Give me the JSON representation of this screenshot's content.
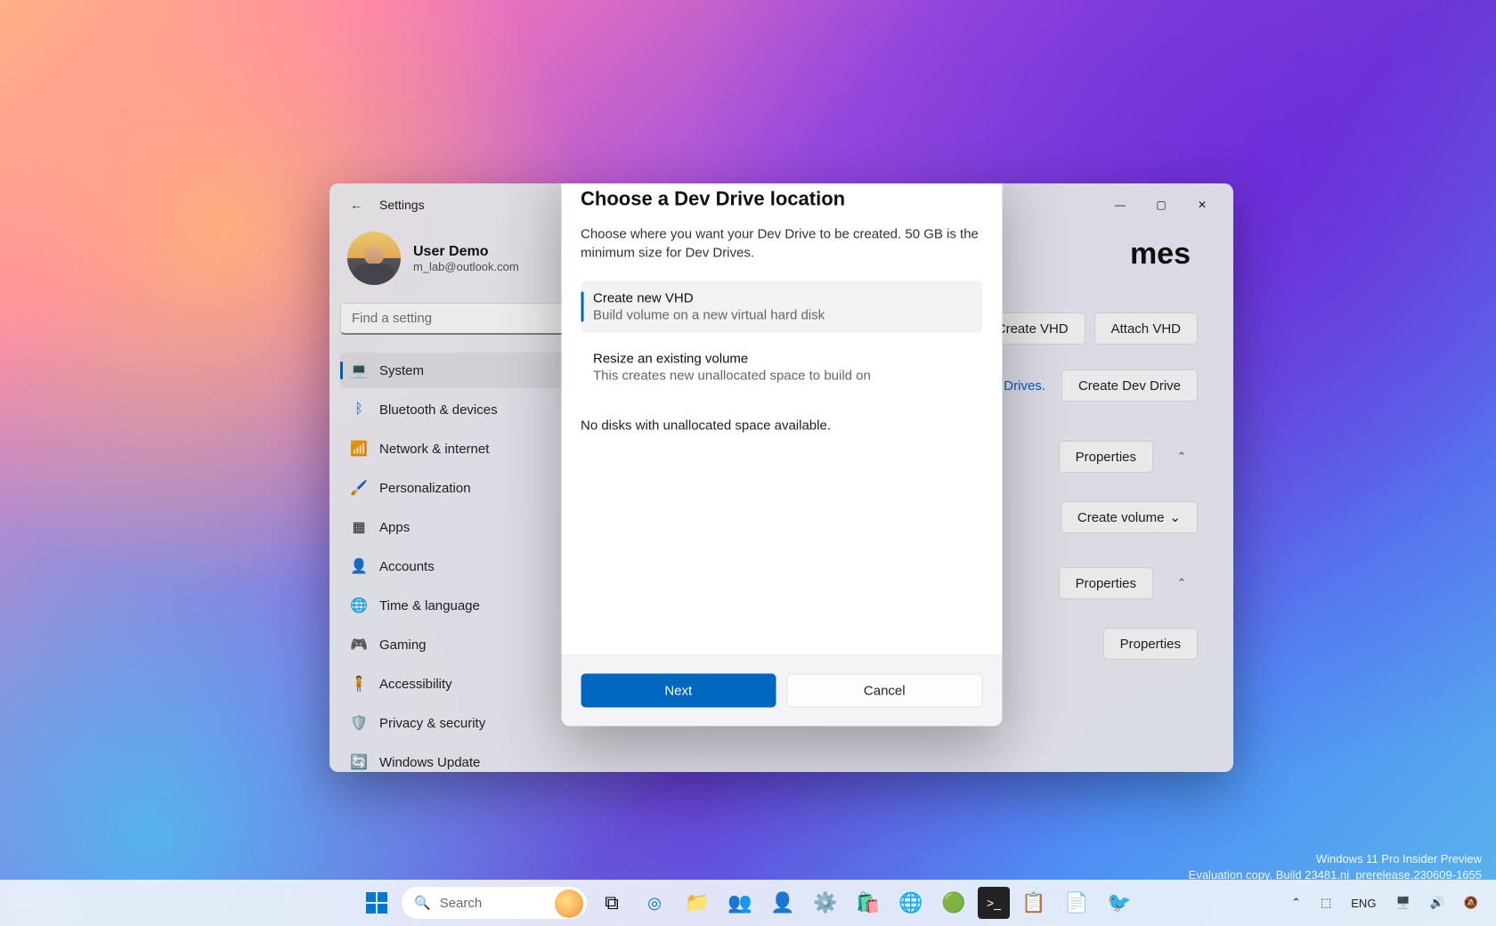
{
  "window": {
    "title": "Settings"
  },
  "user": {
    "name": "User Demo",
    "email": "m_lab@outlook.com"
  },
  "search": {
    "placeholder": "Find a setting"
  },
  "nav": {
    "items": [
      {
        "label": "System",
        "icon": "💻"
      },
      {
        "label": "Bluetooth & devices",
        "icon": "ᛒ"
      },
      {
        "label": "Network & internet",
        "icon": "📶"
      },
      {
        "label": "Personalization",
        "icon": "🖌️"
      },
      {
        "label": "Apps",
        "icon": "▦"
      },
      {
        "label": "Accounts",
        "icon": "👤"
      },
      {
        "label": "Time & language",
        "icon": "🌐"
      },
      {
        "label": "Gaming",
        "icon": "🎮"
      },
      {
        "label": "Accessibility",
        "icon": "🧍"
      },
      {
        "label": "Privacy & security",
        "icon": "🛡️"
      },
      {
        "label": "Windows Update",
        "icon": "🔄"
      }
    ]
  },
  "content": {
    "page_title_suffix": "mes",
    "create_vhd": "Create VHD",
    "attach_vhd": "Attach VHD",
    "dev_link": "Dev Drives.",
    "create_dev_drive": "Create Dev Drive",
    "properties": "Properties",
    "create_volume": "Create volume"
  },
  "dialog": {
    "title": "Choose a Dev Drive location",
    "desc": "Choose where you want your Dev Drive to be created. 50 GB is the minimum size for Dev Drives.",
    "opt1": {
      "title": "Create new VHD",
      "sub": "Build volume on a new virtual hard disk"
    },
    "opt2": {
      "title": "Resize an existing volume",
      "sub": "This creates new unallocated space to build on"
    },
    "no_disk": "No disks with unallocated space available.",
    "next": "Next",
    "cancel": "Cancel"
  },
  "weather": {
    "temp": "60°F",
    "cond": "Cloudy"
  },
  "watermark": {
    "line1": "Windows 11 Pro Insider Preview",
    "line2": "Evaluation copy. Build 23481.ni_prerelease.230609-1655"
  },
  "taskbar": {
    "search": "Search"
  },
  "tray": {
    "lang": "ENG"
  }
}
